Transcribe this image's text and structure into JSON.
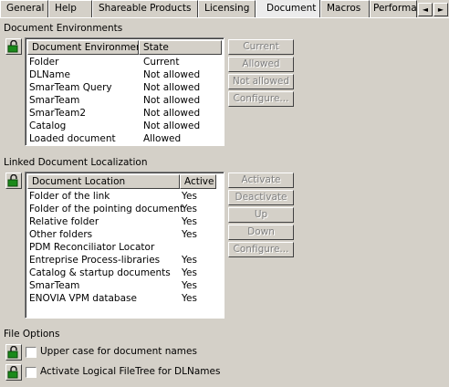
{
  "tabs": [
    "General",
    "Help",
    "Shareable Products",
    "Licensing",
    "Document",
    "Macros",
    "Performa"
  ],
  "active_tab": "Document",
  "scroll_arrows": {
    "left": "◄",
    "right": "►"
  },
  "document_environments": {
    "section_label": "Document Environments",
    "columns": [
      "Document Environment",
      "State"
    ],
    "rows": [
      {
        "name": "Folder",
        "state": "Current"
      },
      {
        "name": "DLName",
        "state": "Not allowed"
      },
      {
        "name": "SmarTeam Query",
        "state": "Not allowed"
      },
      {
        "name": "SmarTeam",
        "state": "Not allowed"
      },
      {
        "name": "SmarTeam2",
        "state": "Not allowed"
      },
      {
        "name": "Catalog",
        "state": "Not allowed"
      },
      {
        "name": "Loaded document",
        "state": "Allowed"
      }
    ],
    "buttons": [
      "Current",
      "Allowed",
      "Not allowed",
      "Configure..."
    ]
  },
  "linked_document_localization": {
    "section_label": "Linked Document Localization",
    "columns": [
      "Document Location",
      "Active"
    ],
    "rows": [
      {
        "location": "Folder of the link",
        "active": "Yes"
      },
      {
        "location": "Folder of the pointing document",
        "active": "Yes"
      },
      {
        "location": "Relative folder",
        "active": "Yes"
      },
      {
        "location": "Other folders",
        "active": "Yes"
      },
      {
        "location": "PDM Reconciliator Locator",
        "active": ""
      },
      {
        "location": "Entreprise Process-libraries",
        "active": "Yes"
      },
      {
        "location": "Catalog & startup documents",
        "active": "Yes"
      },
      {
        "location": "SmarTeam",
        "active": "Yes"
      },
      {
        "location": "ENOVIA VPM  database",
        "active": "Yes"
      }
    ],
    "buttons": [
      "Activate",
      "Deactivate",
      "Up",
      "Down",
      "Configure..."
    ]
  },
  "file_options": {
    "section_label": "File Options",
    "options": [
      {
        "label": "Upper case for document names",
        "checked": false
      },
      {
        "label": "Activate Logical FileTree for DLNames",
        "checked": false
      }
    ]
  },
  "icons": {
    "lock": "lock-icon"
  },
  "colors": {
    "face": "#d4d0c8",
    "lock_green": "#1a8a1a",
    "disabled_text": "#808080"
  }
}
